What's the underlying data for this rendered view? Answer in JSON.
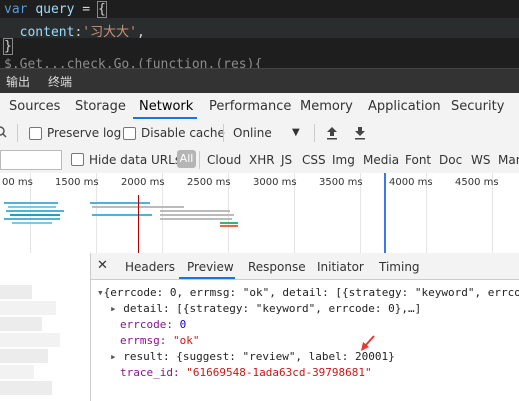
{
  "editor": {
    "line1": {
      "kw": "var",
      "name": "query",
      "op": "=",
      "brace": "{"
    },
    "line2": {
      "key": "content",
      "colon": ":",
      "value": "'习大大'",
      "comma": ","
    },
    "line3": {
      "brace": "}"
    },
    "line4": "$.Get...check.Go.(function.(res){"
  },
  "drawer": {
    "tabs": [
      "输出",
      "终端"
    ]
  },
  "main_tabs": [
    "Sources",
    "Storage",
    "Network",
    "Performance",
    "Memory",
    "Application",
    "Security"
  ],
  "main_tab_active": "Network",
  "toolbar": {
    "preserve_log": "Preserve log",
    "disable_cache": "Disable cache",
    "throttle": "Online"
  },
  "filter": {
    "hide_data_urls": "Hide data URLs",
    "all": "All",
    "types": [
      "Cloud",
      "XHR",
      "JS",
      "CSS",
      "Img",
      "Media",
      "Font",
      "Doc",
      "WS",
      "Mar"
    ]
  },
  "timeline": {
    "ticks": [
      "00 ms",
      "1500 ms",
      "2000 ms",
      "2500 ms",
      "3000 ms",
      "3500 ms",
      "4000 ms",
      "4500 ms"
    ]
  },
  "detail": {
    "tabs": [
      "Headers",
      "Preview",
      "Response",
      "Initiator",
      "Timing"
    ],
    "active_tab": "Preview",
    "summary": "{errcode: 0, errmsg: \"ok\", detail: [{strategy: \"keyword\", errco",
    "detail_line": "detail: [{strategy: \"keyword\", errcode: 0},…]",
    "errcode_key": "errcode:",
    "errcode_val": "0",
    "errmsg_key": "errmsg:",
    "errmsg_val": "\"ok\"",
    "result_line": "result: {suggest: \"review\", label: 20001}",
    "trace_key": "trace_id:",
    "trace_val": "\"61669548-1ada63cd-39798681\""
  },
  "colors": {
    "accent": "#1a73e8",
    "annotation_arrow": "#e53935",
    "dom_loaded": "#3b78e7",
    "load": "#b00000"
  }
}
